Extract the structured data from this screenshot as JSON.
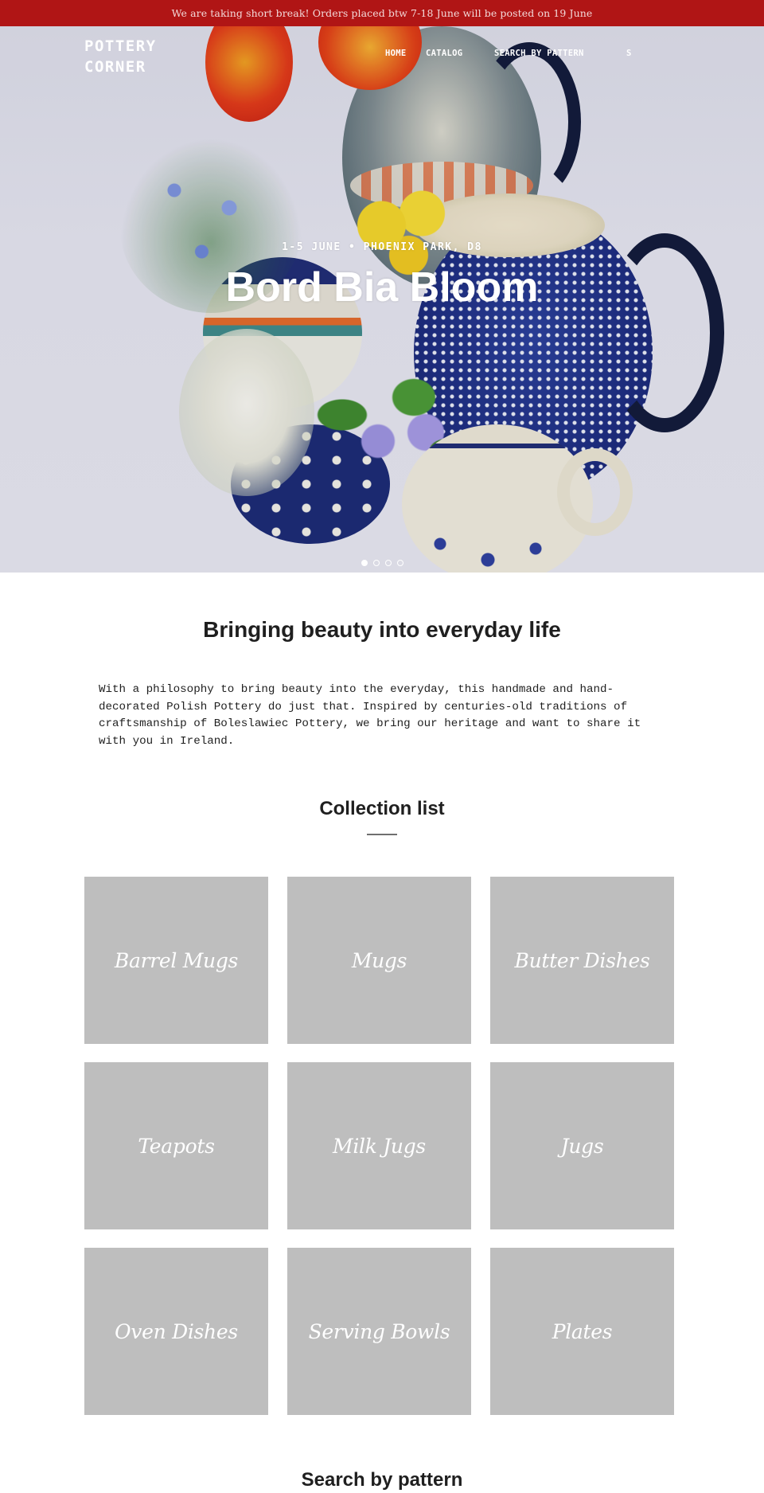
{
  "announcement": {
    "text": "We are taking short break! Orders placed btw 7-18 June will be posted on 19 June",
    "background": "#b01515"
  },
  "header": {
    "logo": "POTTERY CORNER",
    "nav": [
      {
        "label": "HOME"
      },
      {
        "label": "CATALOG"
      },
      {
        "label": "SEARCH BY PATTERN"
      },
      {
        "label": "S"
      }
    ]
  },
  "hero": {
    "subtitle": "1-5 JUNE • PHOENIX PARK, D8",
    "title": "Bord Bia Bloom",
    "image": "polish-pottery-jugs-with-flowers",
    "slides": [
      {
        "label": "slide 1",
        "active": true
      },
      {
        "label": "slide 2",
        "active": false
      },
      {
        "label": "slide 3",
        "active": false
      },
      {
        "label": "slide 4",
        "active": false
      }
    ]
  },
  "intro": {
    "title": "Bringing beauty into everyday life",
    "body": "With a philosophy to bring beauty into the everyday, this handmade and hand-decorated Polish Pottery do just that. Inspired by centuries-old traditions of craftsmanship of Boleslawiec Pottery, we bring our heritage and want to share it with you in Ireland."
  },
  "collections": {
    "title": "Collection list",
    "items": [
      {
        "label": "Barrel Mugs"
      },
      {
        "label": "Mugs"
      },
      {
        "label": "Butter Dishes"
      },
      {
        "label": "Teapots"
      },
      {
        "label": "Milk Jugs"
      },
      {
        "label": "Jugs"
      },
      {
        "label": "Oven Dishes"
      },
      {
        "label": "Serving Bowls"
      },
      {
        "label": "Plates"
      }
    ]
  },
  "pattern_section": {
    "title": "Search by pattern"
  }
}
